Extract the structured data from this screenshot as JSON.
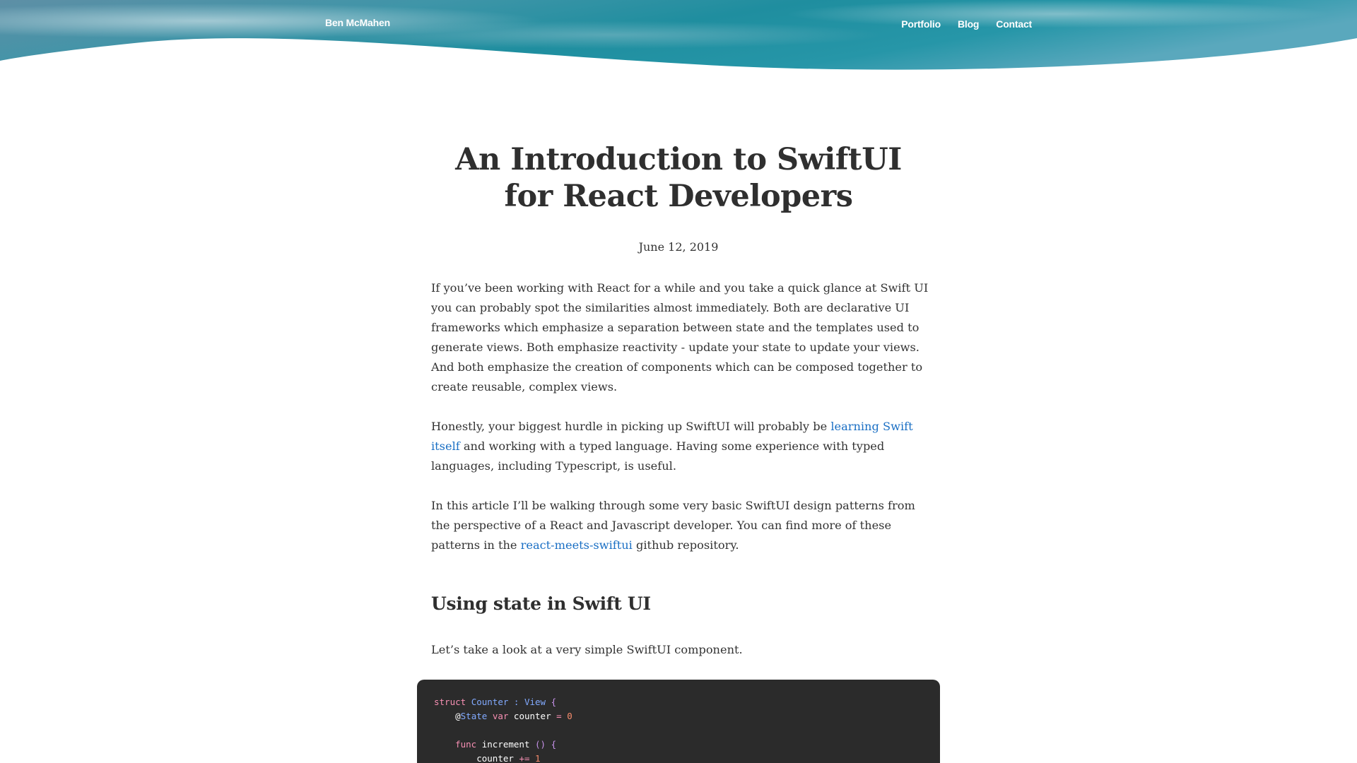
{
  "header": {
    "site_name": "Ben McMahen",
    "nav": [
      "Portfolio",
      "Blog",
      "Contact"
    ]
  },
  "article": {
    "title": "An Introduction to SwiftUI for React Developers",
    "date": "June 12, 2019",
    "p1": "If you’ve been working with React for a while and you take a quick glance at Swift UI you can probably spot the similarities almost immediately. Both are declarative UI frameworks which emphasize a separation between state and the templates used to generate views. Both emphasize reactivity - update your state to update your views. And both emphasize the creation of components which can be composed together to create reusable, complex views.",
    "p2_before": "Honestly, your biggest hurdle in picking up SwiftUI will probably be ",
    "p2_link": "learning Swift itself",
    "p2_after": " and working with a typed language. Having some experience with typed languages, including Typescript, is useful.",
    "p3_before": "In this article I’ll be walking through some very basic SwiftUI design patterns from the perspective of a React and Javascript developer. You can find more of these patterns in the ",
    "p3_link": "react-meets-swiftui",
    "p3_after": " github repository.",
    "h2": "Using state in Swift UI",
    "p4": "Let’s take a look at a very simple SwiftUI component."
  },
  "code": {
    "lines": [
      "struct Counter : View {",
      "    @State var counter = 0",
      "",
      "    func increment () {",
      "        counter += 1"
    ]
  },
  "colors": {
    "banner_teal": "#1a8c9a",
    "link": "#1a6fc4",
    "code_bg": "#2b2b2b",
    "keyword": "#f78fb3",
    "type": "#82aaff",
    "number": "#f78c6c"
  }
}
